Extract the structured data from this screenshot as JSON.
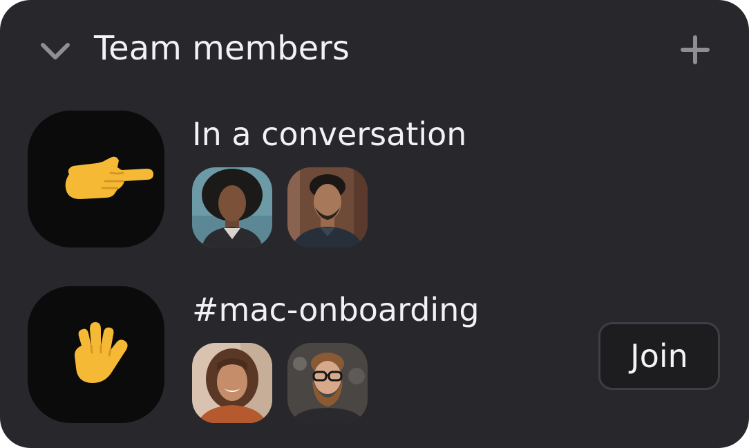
{
  "header": {
    "title": "Team members",
    "collapse_icon": "chevron-down-icon",
    "add_icon": "plus-icon"
  },
  "rows": [
    {
      "label": "In a conversation",
      "status_icon": "pointing-hand-emoji",
      "members": [
        "member-avatar",
        "member-avatar"
      ]
    },
    {
      "label": "#mac-onboarding",
      "status_icon": "raised-hand-emoji",
      "members": [
        "member-avatar",
        "member-avatar"
      ],
      "action_label": "Join"
    }
  ],
  "colors": {
    "panel_bg": "#28282c",
    "tile_bg": "#0b0b0c",
    "text": "#f2f2f4",
    "muted_icon": "#8e8e93",
    "button_bg": "#1d1d20",
    "button_border": "#3e3e44"
  }
}
